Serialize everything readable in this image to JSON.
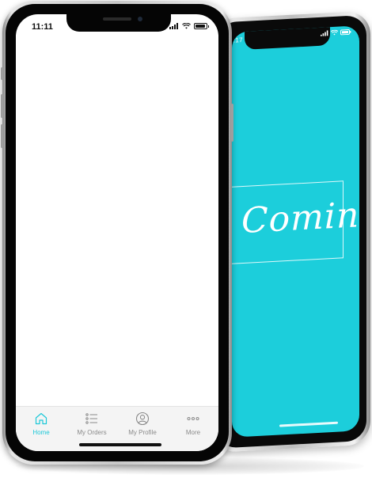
{
  "colors": {
    "accent": "#1cc8d8",
    "splash_background": "#1ccedb",
    "tab_inactive": "#8a8a8a",
    "tab_bar_background": "#f4f4f4"
  },
  "front_phone": {
    "status_bar": {
      "time": "11:11"
    },
    "tab_bar": {
      "tabs": [
        {
          "label": "Home",
          "icon": "home-icon",
          "active": true
        },
        {
          "label": "My Orders",
          "icon": "list-icon",
          "active": false
        },
        {
          "label": "My Profile",
          "icon": "profile-icon",
          "active": false
        },
        {
          "label": "More",
          "icon": "more-dots-icon",
          "active": false
        }
      ]
    }
  },
  "back_phone": {
    "status_bar": {
      "time": ":17"
    },
    "logo_text": "Comin"
  }
}
